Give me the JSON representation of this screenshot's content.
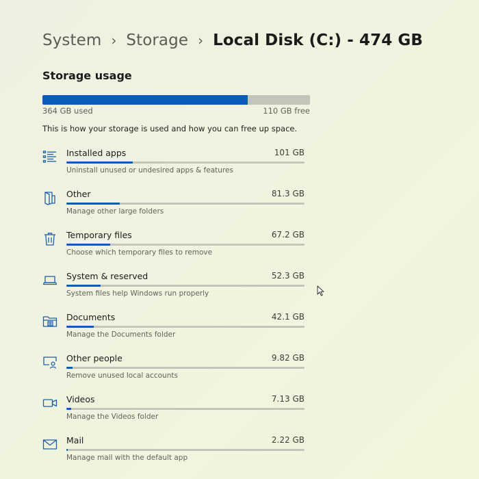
{
  "breadcrumb": {
    "items": [
      "System",
      "Storage"
    ],
    "current": "Local Disk (C:) - 474 GB",
    "separator": "›"
  },
  "storage_usage": {
    "title": "Storage usage",
    "used_label": "364 GB used",
    "free_label": "110 GB free",
    "used_fraction": 0.768,
    "description": "This is how your storage is used and how you can free up space."
  },
  "categories": [
    {
      "name": "Installed apps",
      "size": "101 GB",
      "description": "Uninstall unused or undesired apps & features",
      "fill_fraction": 0.278,
      "icon": "apps-list-icon"
    },
    {
      "name": "Other",
      "size": "81.3 GB",
      "description": "Manage other large folders",
      "fill_fraction": 0.223,
      "icon": "folder-other-icon"
    },
    {
      "name": "Temporary files",
      "size": "67.2 GB",
      "description": "Choose which temporary files to remove",
      "fill_fraction": 0.185,
      "icon": "trash-icon"
    },
    {
      "name": "System & reserved",
      "size": "52.3 GB",
      "description": "System files help Windows run properly",
      "fill_fraction": 0.144,
      "icon": "laptop-icon"
    },
    {
      "name": "Documents",
      "size": "42.1 GB",
      "description": "Manage the Documents folder",
      "fill_fraction": 0.116,
      "icon": "documents-folder-icon"
    },
    {
      "name": "Other people",
      "size": "9.82 GB",
      "description": "Remove unused local accounts",
      "fill_fraction": 0.027,
      "icon": "person-monitor-icon"
    },
    {
      "name": "Videos",
      "size": "7.13 GB",
      "description": "Manage the Videos folder",
      "fill_fraction": 0.02,
      "icon": "video-camera-icon"
    },
    {
      "name": "Mail",
      "size": "2.22 GB",
      "description": "Manage mail with the default app",
      "fill_fraction": 0.006,
      "icon": "mail-icon"
    }
  ],
  "colors": {
    "accent": "#0b5cb6",
    "track": "#c2c6b9",
    "icon": "#1a5fa8"
  }
}
